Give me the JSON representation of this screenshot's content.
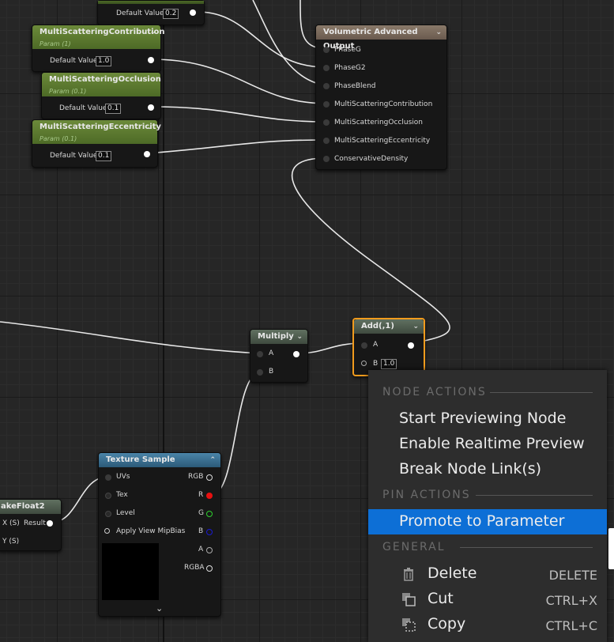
{
  "nodes": {
    "top_partial": {
      "label": "Default Value",
      "value": "0.2"
    },
    "multi_contribution": {
      "title": "MultiScatteringContribution",
      "sub": "Param (1)",
      "label": "Default Value",
      "value": "1.0"
    },
    "multi_occlusion": {
      "title": "MultiScatteringOcclusion",
      "sub": "Param (0.1)",
      "label": "Default Value",
      "value": "0.1"
    },
    "multi_eccentricity": {
      "title": "MultiScatteringEccentricity",
      "sub": "Param (0.1)",
      "label": "Default Value",
      "value": "0.1"
    },
    "output": {
      "title": "Volumetric Advanced Output",
      "pins": [
        "PhaseG",
        "PhaseG2",
        "PhaseBlend",
        "MultiScatteringContribution",
        "MultiScatteringOcclusion",
        "MultiScatteringEccentricity",
        "ConservativeDensity"
      ]
    },
    "multiply": {
      "title": "Multiply",
      "pin_a": "A",
      "pin_b": "B"
    },
    "add": {
      "title": "Add(,1)",
      "pin_a": "A",
      "pin_b": "B",
      "value": "1.0"
    },
    "texture": {
      "title": "Texture Sample",
      "inputs": [
        "UVs",
        "Tex",
        "Level",
        "Apply View MipBias"
      ],
      "outputs": [
        "RGB",
        "R",
        "G",
        "B",
        "A",
        "RGBA"
      ],
      "expand": "⌄"
    },
    "makefloat": {
      "title": "akeFloat2",
      "pin_x": "X (S)",
      "pin_y": "Y (S)",
      "out": "Result"
    }
  },
  "context_menu": {
    "node_actions": "NODE ACTIONS",
    "start_preview": "Start Previewing Node",
    "realtime_preview": "Enable Realtime Preview",
    "break_links": "Break Node Link(s)",
    "pin_actions": "PIN ACTIONS",
    "promote": "Promote to Parameter",
    "general": "GENERAL",
    "delete": "Delete",
    "delete_sc": "DELETE",
    "cut": "Cut",
    "cut_sc": "CTRL+X",
    "copy": "Copy",
    "copy_sc": "CTRL+C"
  },
  "colors": {
    "accent": "#0d6fd6",
    "selection": "#f29b1d",
    "param_header": "#5f7d32",
    "output_header": "#7a6a5c"
  }
}
